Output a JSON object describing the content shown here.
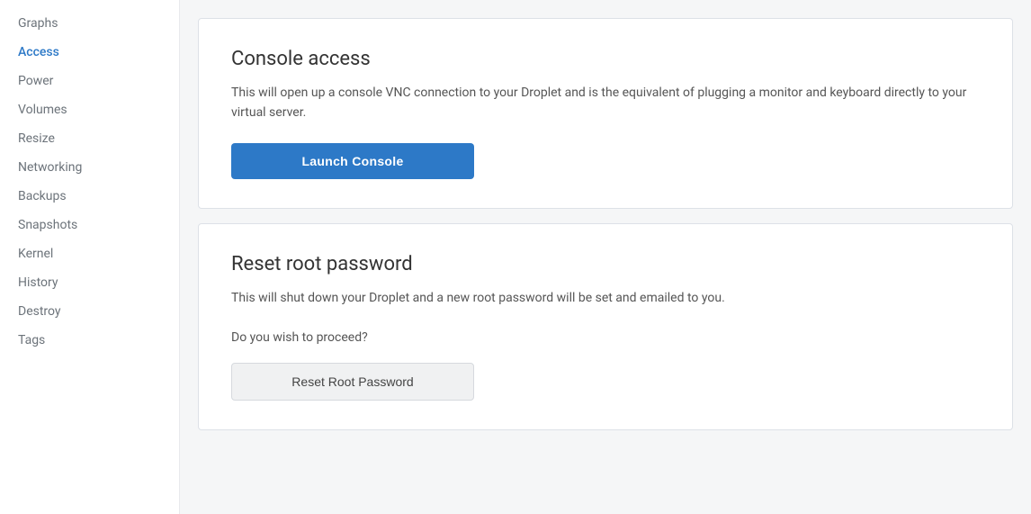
{
  "sidebar": {
    "items": [
      {
        "label": "Graphs",
        "id": "graphs",
        "active": false
      },
      {
        "label": "Access",
        "id": "access",
        "active": true
      },
      {
        "label": "Power",
        "id": "power",
        "active": false
      },
      {
        "label": "Volumes",
        "id": "volumes",
        "active": false
      },
      {
        "label": "Resize",
        "id": "resize",
        "active": false
      },
      {
        "label": "Networking",
        "id": "networking",
        "active": false
      },
      {
        "label": "Backups",
        "id": "backups",
        "active": false
      },
      {
        "label": "Snapshots",
        "id": "snapshots",
        "active": false
      },
      {
        "label": "Kernel",
        "id": "kernel",
        "active": false
      },
      {
        "label": "History",
        "id": "history",
        "active": false
      },
      {
        "label": "Destroy",
        "id": "destroy",
        "active": false
      },
      {
        "label": "Tags",
        "id": "tags",
        "active": false
      }
    ]
  },
  "console_card": {
    "title": "Console access",
    "description": "This will open up a console VNC connection to your Droplet and is the equivalent of plugging a monitor and keyboard directly to your virtual server.",
    "button_label": "Launch Console"
  },
  "password_card": {
    "title": "Reset root password",
    "description": "This will shut down your Droplet and a new root password will be set and emailed to you.",
    "sub_description": "Do you wish to proceed?",
    "button_label": "Reset Root Password"
  }
}
